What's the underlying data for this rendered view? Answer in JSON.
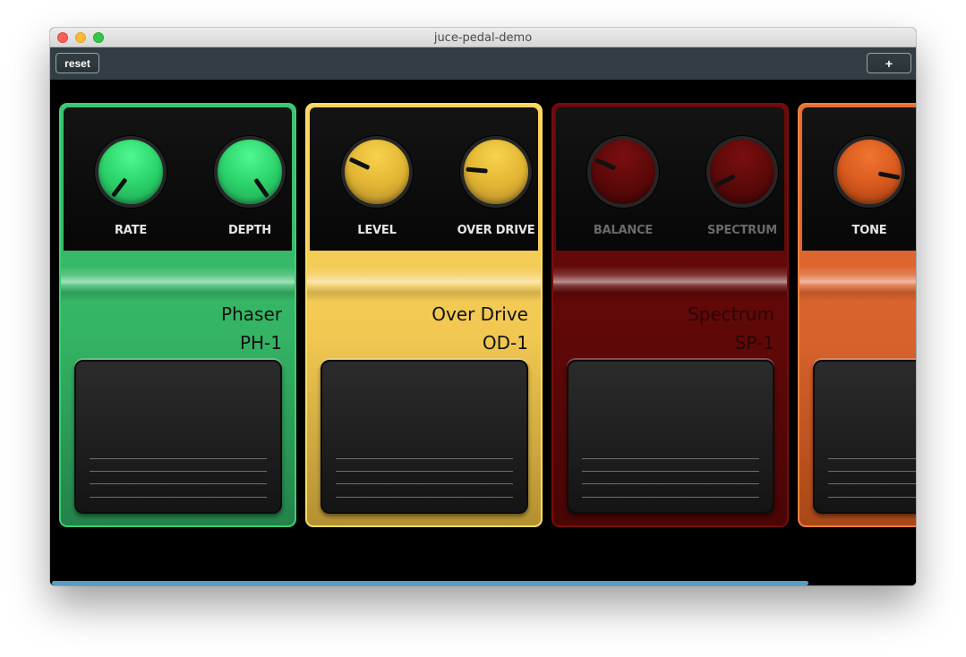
{
  "window": {
    "title": "juce-pedal-demo",
    "traffic_lights": {
      "close": "#fc5f57",
      "minimize": "#fdbc2f",
      "maximize": "#34c84a"
    }
  },
  "toolbar": {
    "reset_label": "reset",
    "add_label": "+",
    "background": "#323e44"
  },
  "pedals": [
    {
      "name": "Phaser",
      "model": "PH-1",
      "active": true,
      "colors": {
        "edge": "#3ecf73",
        "light": "#3bc472",
        "mid": "#34b464",
        "dark": "#23824a",
        "knob_hi": "#4ff890",
        "knob_mid": "#2bd36a",
        "knob_lo": "#1f9e52"
      },
      "knobs": [
        {
          "label": "RATE",
          "angle": 37
        },
        {
          "label": "DEPTH",
          "angle": -35
        }
      ]
    },
    {
      "name": "Over Drive",
      "model": "OD-1",
      "active": true,
      "colors": {
        "edge": "#ffdc66",
        "light": "#fcd35d",
        "mid": "#f1c852",
        "dark": "#b49032",
        "knob_hi": "#f6d24e",
        "knob_mid": "#e3b632",
        "knob_lo": "#a9822a"
      },
      "knobs": [
        {
          "label": "LEVEL",
          "angle": 115
        },
        {
          "label": "OVER DRIVE",
          "angle": 95
        }
      ]
    },
    {
      "name": "Spectrum",
      "model": "SP-1",
      "active": false,
      "colors": {
        "edge": "#7a0c0c",
        "light": "#6b0a0a",
        "mid": "#600808",
        "dark": "#4a0505",
        "knob_hi": "#7a0f0f",
        "knob_mid": "#5e0909",
        "knob_lo": "#3d0505"
      },
      "knobs": [
        {
          "label": "BALANCE",
          "angle": 113
        },
        {
          "label": "SPECTRUM",
          "angle": 63
        }
      ]
    },
    {
      "name": "",
      "model": "",
      "active": true,
      "colors": {
        "edge": "#f0803e",
        "light": "#e96c32",
        "mid": "#d8622c",
        "dark": "#a94818",
        "knob_hi": "#f27430",
        "knob_mid": "#d85a1e",
        "knob_lo": "#9c3a10"
      },
      "knobs": [
        {
          "label": "TONE",
          "angle": -79
        }
      ]
    }
  ],
  "scroll": {
    "visible_fraction": 0.877,
    "position": 0.0,
    "thumb_color": "#5a9ec6"
  }
}
